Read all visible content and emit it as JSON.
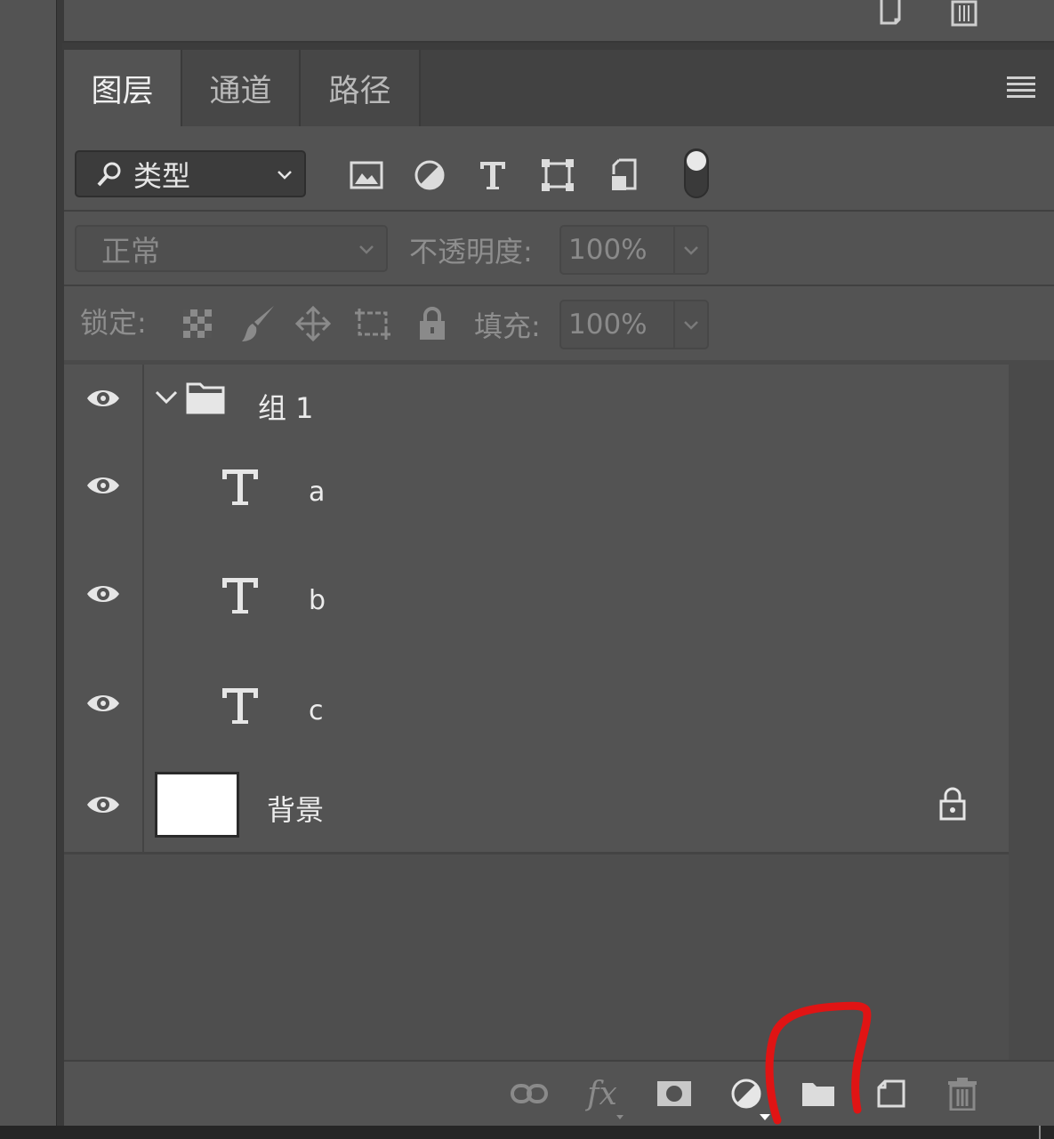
{
  "tabs": [
    {
      "label": "图层",
      "active": true
    },
    {
      "label": "通道",
      "active": false
    },
    {
      "label": "路径",
      "active": false
    }
  ],
  "filter": {
    "kind_label": "类型",
    "icons": [
      "image-filter-icon",
      "adjustment-filter-icon",
      "type-filter-icon",
      "shape-filter-icon",
      "smart-object-filter-icon",
      "filter-toggle-icon"
    ]
  },
  "blend": {
    "mode": "正常",
    "opacity_label": "不透明度:",
    "opacity_value": "100%"
  },
  "lock": {
    "label": "锁定:",
    "fill_label": "填充:",
    "fill_value": "100%"
  },
  "layers": [
    {
      "name": "组 1",
      "type": "group",
      "expanded": true
    },
    {
      "name": "a",
      "type": "text"
    },
    {
      "name": "b",
      "type": "text"
    },
    {
      "name": "c",
      "type": "text"
    },
    {
      "name": "背景",
      "type": "background",
      "locked": true
    }
  ],
  "bottom_icons": [
    "link-layers-icon",
    "fx-icon",
    "add-mask-icon",
    "adjustment-layer-icon",
    "new-group-icon",
    "new-layer-icon",
    "delete-layer-icon"
  ],
  "bottom": {
    "fx_label": "fx"
  },
  "annotation_color": "#e01414"
}
